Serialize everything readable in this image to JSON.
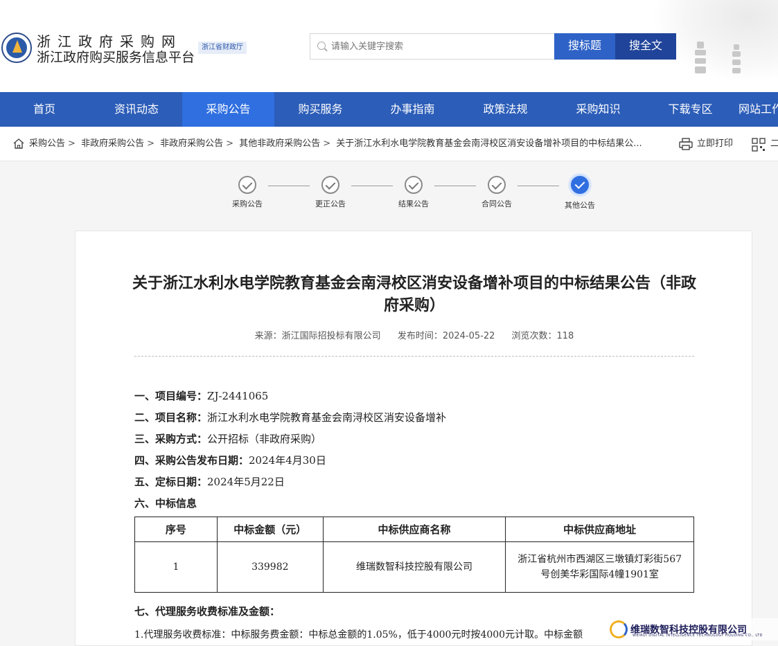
{
  "header": {
    "site_title": "浙江政府采购网",
    "site_subtitle": "浙江政府购买服务信息平台",
    "dept_badge": "浙江省财政厅",
    "search_placeholder": "请输入关键字搜索",
    "search_title_button": "搜标题",
    "search_full_button": "搜全文"
  },
  "nav": {
    "items": [
      "首页",
      "资讯动态",
      "采购公告",
      "购买服务",
      "办事指南",
      "政策法规",
      "采购知识",
      "下载专区",
      "网站工作"
    ],
    "active_index": 2
  },
  "breadcrumb": {
    "items": [
      "采购公告",
      "非政府采购公告",
      "非政府采购公告",
      "其他非政府采购公告",
      "关于浙江水利水电学院教育基金会南浔校区消安设备增补项目的中标结果公..."
    ],
    "print_label": "立即打印",
    "qr_label": "二"
  },
  "steps": {
    "items": [
      "采购公告",
      "更正公告",
      "结果公告",
      "合同公告",
      "其他公告"
    ],
    "current_index": 4
  },
  "article": {
    "title": "关于浙江水利水电学院教育基金会南浔校区消安设备增补项目的中标结果公告（非政府采购）",
    "source": "来源：浙江国际招投标有限公司",
    "publish_time": "发布时间：2024-05-22",
    "views": "浏览次数：118",
    "fields": [
      {
        "label": "一、项目编号：",
        "value": "ZJ-2441065"
      },
      {
        "label": "二、项目名称：",
        "value": "浙江水利水电学院教育基金会南浔校区消安设备增补"
      },
      {
        "label": "三、采购方式：",
        "value": "公开招标（非政府采购）"
      },
      {
        "label": "四、采购公告发布日期：",
        "value": "2024年4月30日"
      },
      {
        "label": "五、定标日期：",
        "value": "2024年5月22日"
      },
      {
        "label": "六、中标信息",
        "value": ""
      }
    ],
    "table": {
      "headers": [
        "序号",
        "中标金额（元）",
        "中标供应商名称",
        "中标供应商地址"
      ],
      "rows": [
        [
          "1",
          "339982",
          "维瑞数智科技控股有限公司",
          "浙江省杭州市西湖区三墩镇灯彩街567号创美华彩国际4幢1901室"
        ]
      ]
    },
    "section7_label": "七、代理服务收费标准及金额：",
    "fee_line": "1.代理服务收费标准：中标服务费金额：中标总金额的1.05%，低于4000元时按4000元计取。中标金额"
  },
  "watermark": {
    "name": "维瑞数智科技控股有限公司",
    "english": "WEIRUI DIGITAL INTELLIGENCE TECHNOLOGY HOLDING CO., LTD"
  },
  "colors": {
    "nav_bg": "#2c5db8",
    "nav_active": "#2f6fe0",
    "button_primary": "#2e62c7",
    "button_dark": "#20449a"
  }
}
